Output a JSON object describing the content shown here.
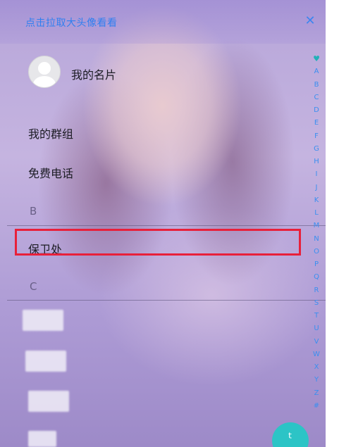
{
  "header": {
    "hint": "点击拉取大头像看看",
    "close_icon": "close-icon"
  },
  "profile": {
    "avatar_icon": "avatar-placeholder-icon",
    "label": "我的名片"
  },
  "menu": {
    "groups": "我的群组",
    "free_call": "免费电话"
  },
  "sections": [
    {
      "letter": "B",
      "contacts": [
        "保卫处"
      ]
    },
    {
      "letter": "C",
      "contacts": []
    }
  ],
  "index_bar": {
    "favorite_icon": "heart-icon",
    "letters": [
      "A",
      "B",
      "C",
      "D",
      "E",
      "F",
      "G",
      "H",
      "I",
      "J",
      "K",
      "L",
      "M",
      "N",
      "O",
      "P",
      "Q",
      "R",
      "S",
      "T",
      "U",
      "V",
      "W",
      "X",
      "Y",
      "Z",
      "#"
    ]
  },
  "fab": {
    "icon": "dial-icon",
    "glyph": "ᵗ"
  },
  "colors": {
    "accent": "#2f7ff0",
    "highlight_border": "#e8203a",
    "fab": "#2cc4c6"
  }
}
